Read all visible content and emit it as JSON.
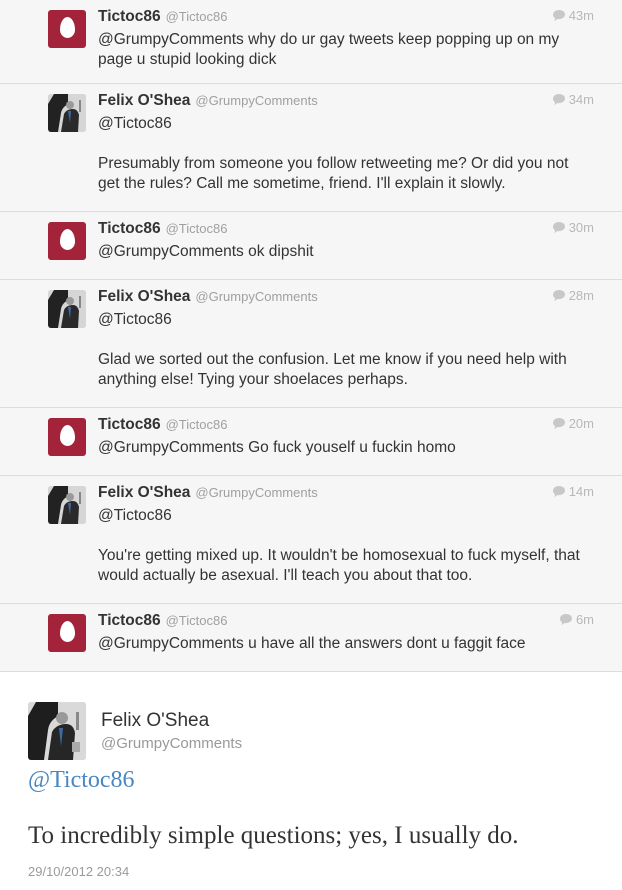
{
  "thread": [
    {
      "author": "Tictoc86",
      "handle": "@Tictoc86",
      "time": "43m",
      "avatar": "egg-icon",
      "text": "@GrumpyComments why do ur gay tweets keep popping up on my page u stupid looking dick"
    },
    {
      "author": "Felix O'Shea",
      "handle": "@GrumpyComments",
      "time": "34m",
      "avatar": "profile-photo",
      "text": "@Tictoc86\n\nPresumably from someone you follow retweeting me? Or did you not get the rules? Call me sometime, friend. I'll explain it slowly."
    },
    {
      "author": "Tictoc86",
      "handle": "@Tictoc86",
      "time": "30m",
      "avatar": "egg-icon",
      "text": "@GrumpyComments ok dipshit"
    },
    {
      "author": "Felix O'Shea",
      "handle": "@GrumpyComments",
      "time": "28m",
      "avatar": "profile-photo",
      "text": "@Tictoc86\n\nGlad we sorted out the confusion. Let me know if you need help with anything else! Tying your shoelaces perhaps."
    },
    {
      "author": "Tictoc86",
      "handle": "@Tictoc86",
      "time": "20m",
      "avatar": "egg-icon",
      "text": "@GrumpyComments Go fuck youself u fuckin homo"
    },
    {
      "author": "Felix O'Shea",
      "handle": "@GrumpyComments",
      "time": "14m",
      "avatar": "profile-photo",
      "text": "@Tictoc86\n\nYou're getting mixed up. It wouldn't be homosexual to fuck myself, that would actually be asexual. I'll teach you about that too."
    },
    {
      "author": "Tictoc86",
      "handle": "@Tictoc86",
      "time": "6m",
      "avatar": "egg-icon",
      "text": "@GrumpyComments u have all the answers dont u faggit face"
    }
  ],
  "main": {
    "author": "Felix O'Shea",
    "handle": "@GrumpyComments",
    "reply_to": "@Tictoc86",
    "text": "To incredibly simple questions; yes, I usually do.",
    "date": "29/10/2012 20:34"
  },
  "colors": {
    "egg_bg": "#a3233a",
    "link": "#4a87c2",
    "thread_bg": "#f6f6f6"
  }
}
